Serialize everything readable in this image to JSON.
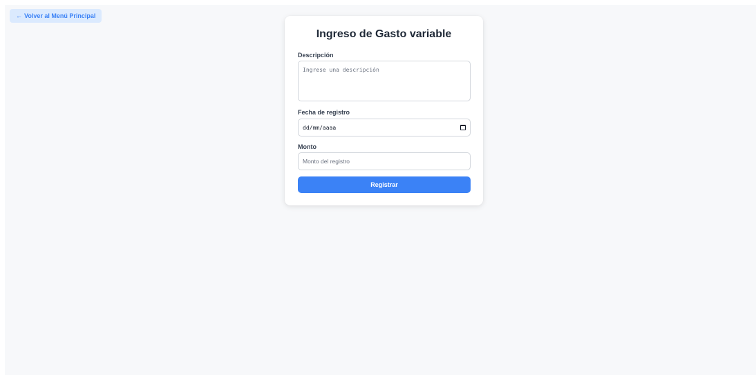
{
  "nav": {
    "back_arrow": "←",
    "back_label": "Volver al Menú Principal"
  },
  "form": {
    "title": "Ingreso de Gasto variable",
    "description": {
      "label": "Descripción",
      "placeholder": "Ingrese una descripción"
    },
    "date": {
      "label": "Fecha de registro",
      "placeholder": "dd/mm/aaaa",
      "icon": "calendar-icon"
    },
    "amount": {
      "label": "Monto",
      "placeholder": "Monto del registro"
    },
    "submit_label": "Registrar"
  },
  "colors": {
    "accent": "#3b82f6",
    "back_button_bg": "#dbeafe",
    "page_bg": "#f7f8fa",
    "title_text": "#1f2937"
  }
}
